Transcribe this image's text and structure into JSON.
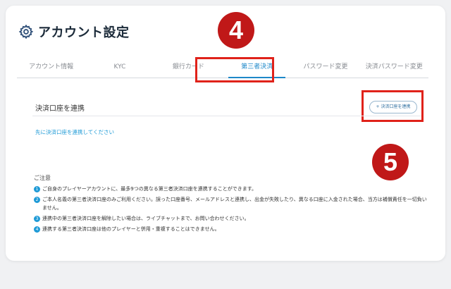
{
  "header": {
    "title": "アカウント設定",
    "icon": "gear-icon"
  },
  "tabs": [
    {
      "label": "アカウント情報",
      "active": false
    },
    {
      "label": "KYC",
      "active": false
    },
    {
      "label": "銀行カード",
      "active": false
    },
    {
      "label": "第三者決済",
      "active": true
    },
    {
      "label": "パスワード変更",
      "active": false
    },
    {
      "label": "決済パスワード変更",
      "active": false
    }
  ],
  "annotations": {
    "badge_tab": "4",
    "badge_button": "5",
    "highlight_color": "#e0221a"
  },
  "section": {
    "label": "決済口座を連携",
    "button": "+ 決済口座を連携",
    "hint": "先に決済口座を連携してください"
  },
  "notes": {
    "title": "ご注意",
    "items": [
      {
        "num": "1",
        "text": "ご自身のプレイヤーアカウントに、最多9つの異なる第三者決済口座を連携することができます。"
      },
      {
        "num": "2",
        "text": "ご本人名義の第三者決済口座のみご利用ください。誤った口座番号、メールアドレスと連携し、出金が失敗したり、異なる口座に入金された場合、当方は補償責任を一切負いません。"
      },
      {
        "num": "3",
        "text": "連携中の第三者決済口座を解除したい場合は、ライブチャットまで、お問い合わせください。"
      },
      {
        "num": "4",
        "text": "連携する第三者決済口座は他のプレイヤーと併用・重複することはできません。"
      }
    ]
  },
  "colors": {
    "accent": "#1e88c9",
    "badge": "#c01818"
  }
}
